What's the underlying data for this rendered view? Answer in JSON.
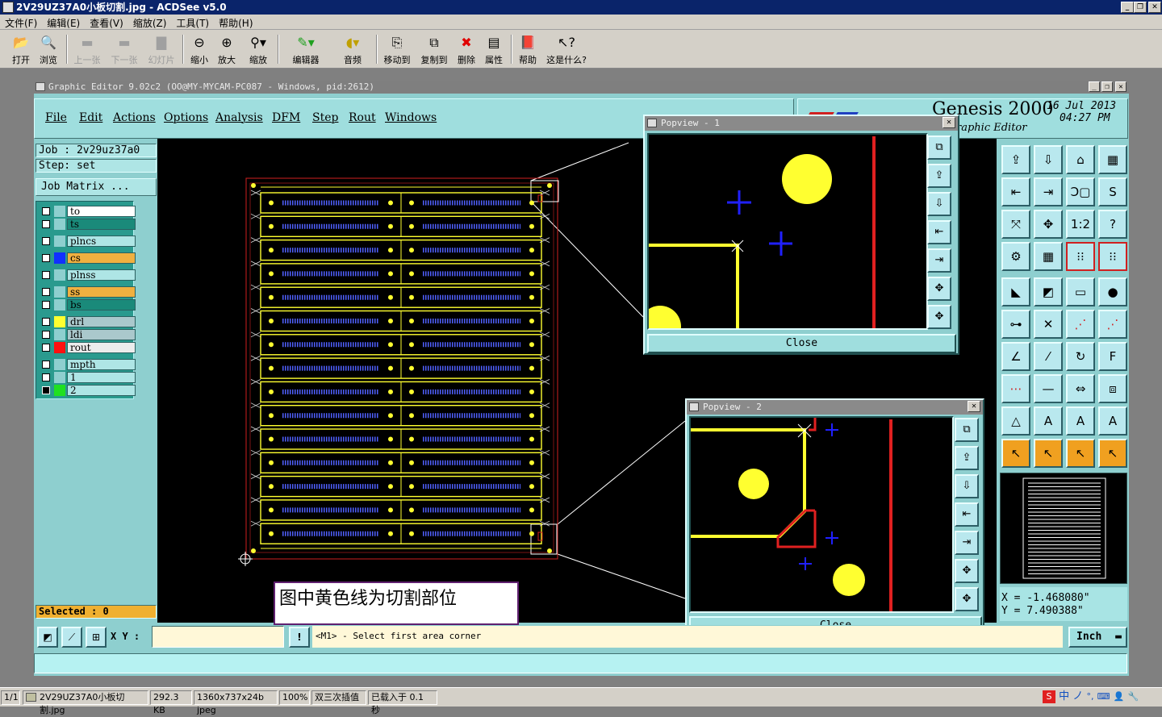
{
  "acdsee": {
    "title": "2V29UZ37A0小板切割.jpg - ACDSee v5.0",
    "menu": [
      "文件(F)",
      "编辑(E)",
      "查看(V)",
      "缩放(Z)",
      "工具(T)",
      "帮助(H)"
    ],
    "toolbar": [
      {
        "label": "打开",
        "icon": "open-folder-icon",
        "enabled": true
      },
      {
        "label": "浏览",
        "icon": "browse-icon",
        "enabled": true
      },
      {
        "label": "上一张",
        "icon": "previous-icon",
        "enabled": false
      },
      {
        "label": "下一张",
        "icon": "next-icon",
        "enabled": false
      },
      {
        "label": "幻灯片",
        "icon": "slideshow-icon",
        "enabled": false
      },
      {
        "label": "缩小",
        "icon": "zoom-out-icon",
        "enabled": true
      },
      {
        "label": "放大",
        "icon": "zoom-in-icon",
        "enabled": true
      },
      {
        "label": "缩放",
        "icon": "zoom-icon",
        "enabled": true
      },
      {
        "label": "编辑器",
        "icon": "editor-icon",
        "enabled": true
      },
      {
        "label": "音频",
        "icon": "audio-icon",
        "enabled": true
      },
      {
        "label": "移动到",
        "icon": "move-to-icon",
        "enabled": true
      },
      {
        "label": "复制到",
        "icon": "copy-to-icon",
        "enabled": true
      },
      {
        "label": "删除",
        "icon": "delete-icon",
        "enabled": true
      },
      {
        "label": "属性",
        "icon": "properties-icon",
        "enabled": true
      },
      {
        "label": "帮助",
        "icon": "help-book-icon",
        "enabled": true
      },
      {
        "label": "这是什么?",
        "icon": "whats-this-icon",
        "enabled": true
      }
    ],
    "status": {
      "index": "1/1",
      "filename": "2V29UZ37A0小板切割.jpg",
      "filesize": "292.3 KB",
      "dimensions": "1360x737x24b jpeg",
      "zoom": "100%",
      "interp": "双三次插值",
      "loaded": "已载入于 0.1 秒"
    },
    "tray": [
      "中",
      "ノ",
      "°,"
    ]
  },
  "genesis": {
    "window_title": "Graphic Editor 9.02c2  (OO@MY-MYCAM-PC087 - Windows, pid:2612)",
    "menu": [
      "File",
      "Edit",
      "Actions",
      "Options",
      "Analysis",
      "DFM",
      "Step",
      "Rout",
      "Windows"
    ],
    "logo": {
      "brand": "Genesis 2000",
      "subtitle": "raphic Editor",
      "date": "16 Jul 2013",
      "time": "04:27 PM"
    },
    "job": {
      "job_label": "Job  : 2v29uz37a0",
      "step_label": "Step: set",
      "matrix_button": "Job Matrix ..."
    },
    "layers": [
      {
        "name": "to",
        "color": "#ffffff",
        "swatch": "",
        "checked": false
      },
      {
        "name": "ts",
        "color": "#1a8a7a",
        "swatch": "",
        "checked": false
      },
      {
        "name": "plncs",
        "color": "#aee5e5",
        "swatch": "",
        "checked": false
      },
      {
        "name": "cs",
        "color": "#f0b040",
        "swatch": "#1030ff",
        "checked": false
      },
      {
        "name": "plnss",
        "color": "#aee5e5",
        "swatch": "",
        "checked": false
      },
      {
        "name": "ss",
        "color": "#f0b040",
        "swatch": "",
        "checked": false
      },
      {
        "name": "bs",
        "color": "#1a8a7a",
        "swatch": "",
        "checked": false
      },
      {
        "name": "drl",
        "color": "#aac8cc",
        "swatch": "#ffff30",
        "checked": false
      },
      {
        "name": "ldi",
        "color": "#aac8cc",
        "swatch": "",
        "checked": false
      },
      {
        "name": "rout",
        "color": "#ececec",
        "swatch": "#ff1010",
        "checked": false
      },
      {
        "name": "mpth",
        "color": "#aee5e5",
        "swatch": "",
        "checked": false
      },
      {
        "name": "1",
        "color": "#aee5e5",
        "swatch": "",
        "checked": false
      },
      {
        "name": "2",
        "color": "#aee5e5",
        "swatch": "#20e020",
        "checked": true
      }
    ],
    "selected": "Selected : 0",
    "popview1": {
      "title": "Popview - 1",
      "close": "Close"
    },
    "popview2": {
      "title": "Popview - 2",
      "close": "Close"
    },
    "coords": {
      "x": "X = -1.468080\"",
      "y": "Y = 7.490388\""
    },
    "xy_label": "X Y :",
    "xy_value": "",
    "prompt": "<M1> - Select first area corner",
    "units": "Inch",
    "note": "图中黄色线为切割部位",
    "right_icons": [
      "send-icon",
      "receive-icon",
      "home-icon",
      "grid-icon",
      "tab-left-icon",
      "tab-right-icon",
      "snap-icon",
      "s-curve-icon",
      "fit-icon",
      "center-icon",
      "scale-icon",
      "help-q-icon",
      "wrench-icon",
      "blank-grid-icon",
      "layers-a-icon",
      "layers-b-icon",
      "measure-icon",
      "pan-icon",
      "ruler-icon",
      "dot-icon",
      "connect-icon",
      "cross-icon",
      "point-icon",
      "point-red-icon",
      "line-a-icon",
      "line-b-icon",
      "arc-icon",
      "flip-icon",
      "minus-icon",
      "width-icon",
      "pads-icon",
      "rect-icon",
      "tri-a-icon",
      "tri-b-icon",
      "tri-c-icon",
      "tri-d-icon",
      "cursor-a-icon",
      "cursor-b-icon",
      "cursor-c-icon",
      "cursor-d-icon"
    ],
    "right_icon_glyphs": [
      "⇪",
      "⇩",
      "⌂",
      "▦",
      "⇤",
      "⇥",
      "Ↄ▢",
      "S",
      "⤧",
      "✥",
      "1:2",
      "?",
      "⚙",
      "▦",
      "⁝⁝",
      "⁝⁝",
      "◣",
      "◩",
      "▭",
      "●",
      "⊶",
      "✕",
      "⋰",
      "⋰",
      "∠",
      "⁄",
      "↻",
      "F",
      "⋯",
      "—",
      "⇔",
      "⧈",
      "△",
      "A",
      "A",
      "A",
      "↖",
      "↖",
      "↖",
      "↖"
    ]
  }
}
